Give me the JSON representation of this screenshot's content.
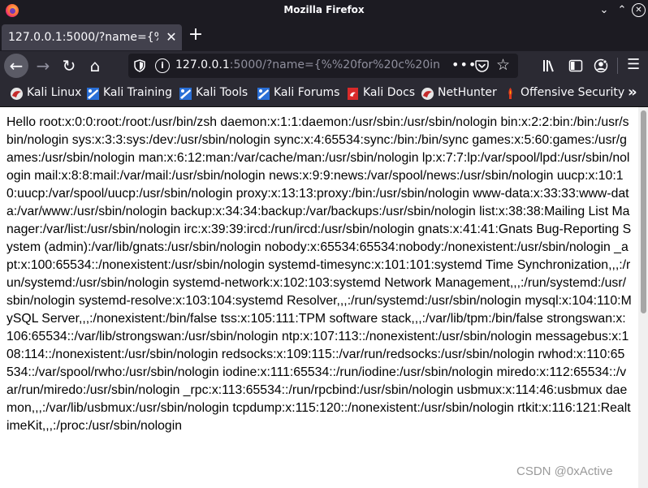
{
  "window": {
    "title": "Mozilla Firefox",
    "minimize_glyph": "⌄",
    "maximize_glyph": "⌃",
    "close_glyph": "✕"
  },
  "tabs": [
    {
      "title": "127.0.0.1:5000/?name={%%",
      "close_glyph": "✕"
    }
  ],
  "newtab_glyph": "+",
  "nav": {
    "back_glyph": "←",
    "forward_glyph": "→",
    "reload_glyph": "↻",
    "home_glyph": "⌂"
  },
  "urlbar": {
    "host": "127.0.0.1",
    "rest": ":5000/?name={%%20for%20c%20in",
    "more_glyph": "•••",
    "star_glyph": "☆",
    "info_glyph": "i"
  },
  "toolbar": {
    "menu_glyph": "☰"
  },
  "bookmarks": {
    "items": [
      {
        "label": "Kali Linux",
        "icon": "kali-dragon-icon"
      },
      {
        "label": "Kali Training",
        "icon": "kali-training-icon"
      },
      {
        "label": "Kali Tools",
        "icon": "kali-tools-icon"
      },
      {
        "label": "Kali Forums",
        "icon": "kali-forums-icon"
      },
      {
        "label": "Kali Docs",
        "icon": "kali-docs-icon"
      },
      {
        "label": "NetHunter",
        "icon": "nethunter-icon"
      },
      {
        "label": "Offensive Security",
        "icon": "offsec-icon"
      }
    ],
    "overflow_glyph": "»"
  },
  "page": {
    "body_text": "Hello root:x:0:0:root:/root:/usr/bin/zsh daemon:x:1:1:daemon:/usr/sbin:/usr/sbin/nologin bin:x:2:2:bin:/bin:/usr/sbin/nologin sys:x:3:3:sys:/dev:/usr/sbin/nologin sync:x:4:65534:sync:/bin:/bin/sync games:x:5:60:games:/usr/games:/usr/sbin/nologin man:x:6:12:man:/var/cache/man:/usr/sbin/nologin lp:x:7:7:lp:/var/spool/lpd:/usr/sbin/nologin mail:x:8:8:mail:/var/mail:/usr/sbin/nologin news:x:9:9:news:/var/spool/news:/usr/sbin/nologin uucp:x:10:10:uucp:/var/spool/uucp:/usr/sbin/nologin proxy:x:13:13:proxy:/bin:/usr/sbin/nologin www-data:x:33:33:www-data:/var/www:/usr/sbin/nologin backup:x:34:34:backup:/var/backups:/usr/sbin/nologin list:x:38:38:Mailing List Manager:/var/list:/usr/sbin/nologin irc:x:39:39:ircd:/run/ircd:/usr/sbin/nologin gnats:x:41:41:Gnats Bug-Reporting System (admin):/var/lib/gnats:/usr/sbin/nologin nobody:x:65534:65534:nobody:/nonexistent:/usr/sbin/nologin _apt:x:100:65534::/nonexistent:/usr/sbin/nologin systemd-timesync:x:101:101:systemd Time Synchronization,,,:/run/systemd:/usr/sbin/nologin systemd-network:x:102:103:systemd Network Management,,,:/run/systemd:/usr/sbin/nologin systemd-resolve:x:103:104:systemd Resolver,,,:/run/systemd:/usr/sbin/nologin mysql:x:104:110:MySQL Server,,,:/nonexistent:/bin/false tss:x:105:111:TPM software stack,,,:/var/lib/tpm:/bin/false strongswan:x:106:65534::/var/lib/strongswan:/usr/sbin/nologin ntp:x:107:113::/nonexistent:/usr/sbin/nologin messagebus:x:108:114::/nonexistent:/usr/sbin/nologin redsocks:x:109:115::/var/run/redsocks:/usr/sbin/nologin rwhod:x:110:65534::/var/spool/rwho:/usr/sbin/nologin iodine:x:111:65534::/run/iodine:/usr/sbin/nologin miredo:x:112:65534::/var/run/miredo:/usr/sbin/nologin _rpc:x:113:65534::/run/rpcbind:/usr/sbin/nologin usbmux:x:114:46:usbmux daemon,,,:/var/lib/usbmux:/usr/sbin/nologin tcpdump:x:115:120::/nonexistent:/usr/sbin/nologin rtkit:x:116:121:RealtimeKit,,,:/proc:/usr/sbin/nologin"
  },
  "watermark": "CSDN @0xActive",
  "colors": {
    "chrome_dark": "#1c1b22",
    "chrome": "#2b2a33",
    "tab_active": "#42414d",
    "text_light": "#fbfbfe",
    "page_bg": "#ffffff"
  }
}
